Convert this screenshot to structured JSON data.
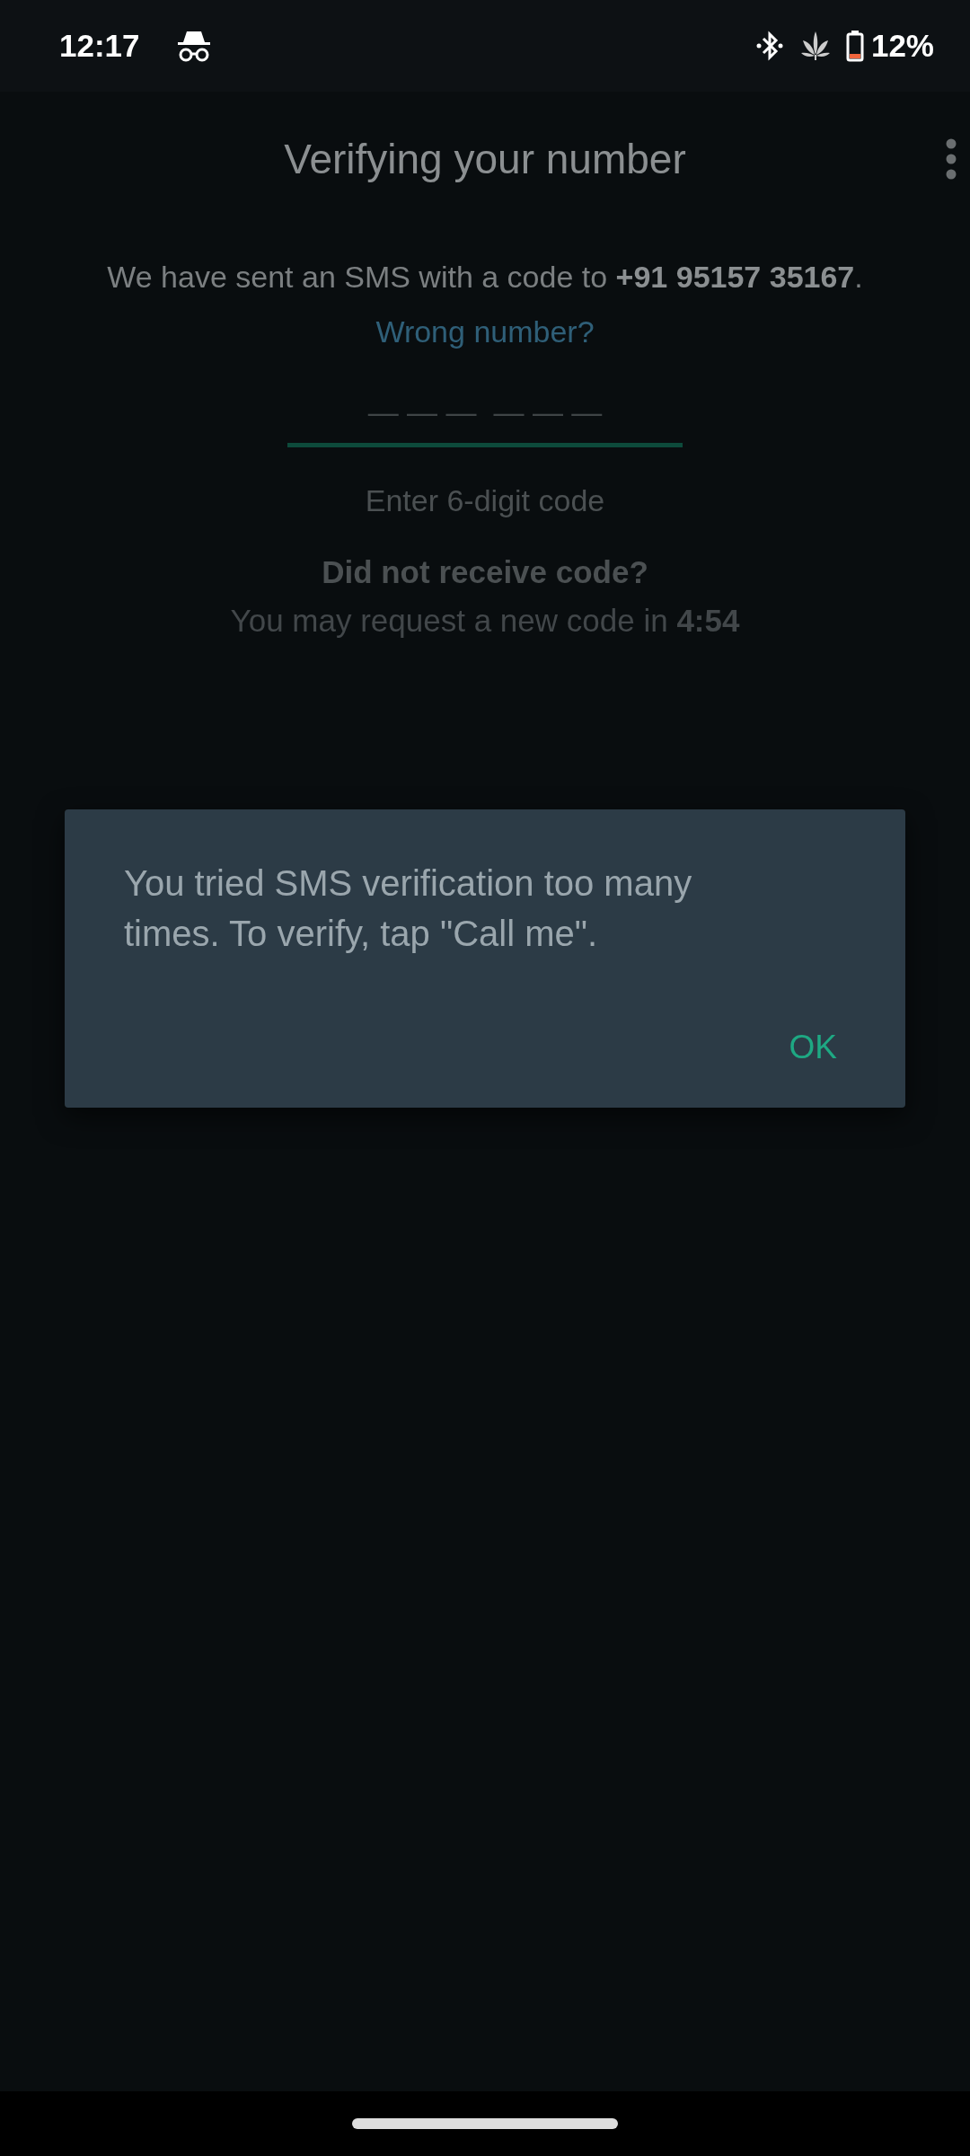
{
  "status_bar": {
    "time": "12:17",
    "battery": "12%"
  },
  "app_bar": {
    "title": "Verifying your number"
  },
  "verification": {
    "message": "We have sent an SMS with a code to **+91 95157 35167**.",
    "wrong_number_link": "Wrong number?",
    "code_field": {
      "placeholder": "— — —  — — —"
    },
    "code_hint": "Enter 6-digit code",
    "resend_title": "Did not receive code?",
    "resend_message": "You may request a new code in **4:54**"
  },
  "dialog": {
    "message": "You tried SMS verification too many times. To verify, tap \"Call me\".",
    "buttons": [
      "OK"
    ]
  }
}
